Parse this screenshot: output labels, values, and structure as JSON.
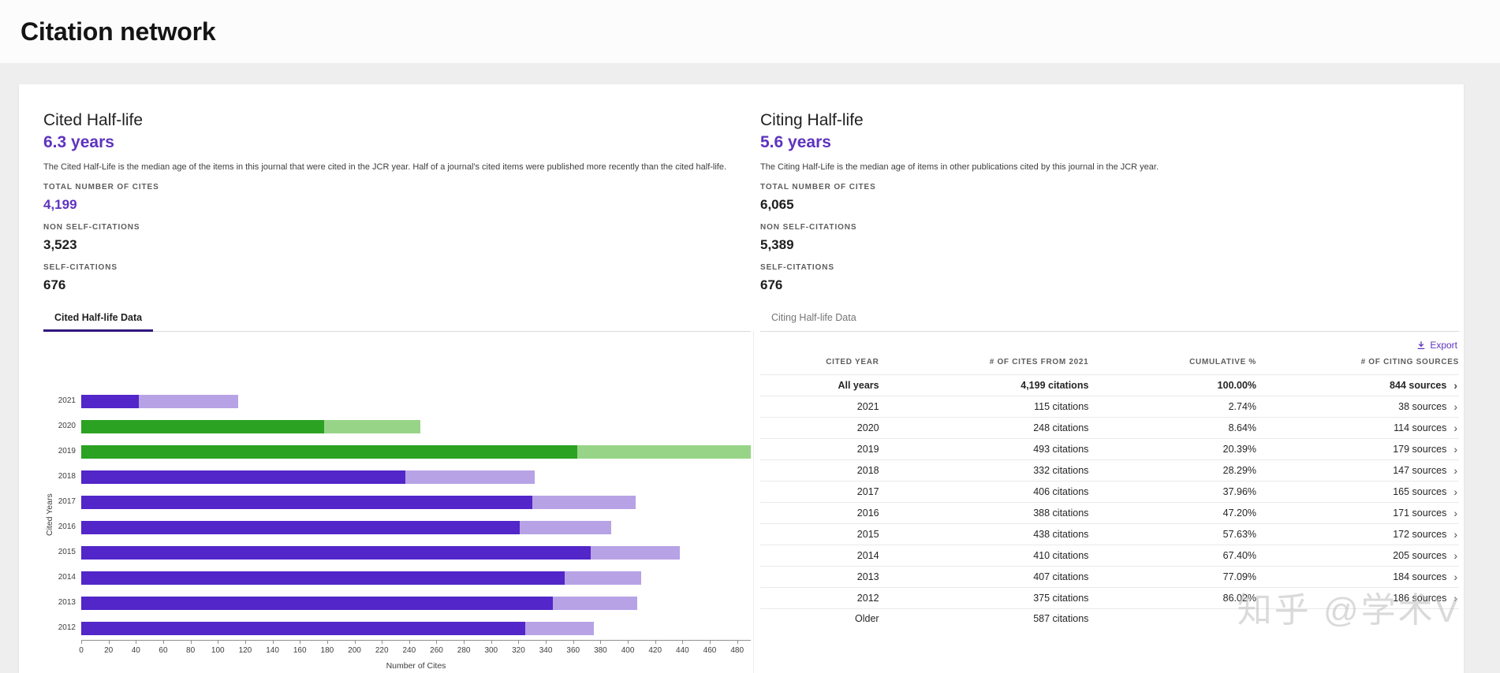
{
  "page": {
    "title": "Citation network"
  },
  "cited_panel": {
    "title": "Cited Half-life",
    "value": "6.3 years",
    "description": "The Cited Half-Life is the median age of the items in this journal that were cited in the JCR year. Half of a journal's cited items were published more recently than the cited half-life.",
    "stats": [
      {
        "label": "TOTAL NUMBER OF CITES",
        "value": "4,199"
      },
      {
        "label": "NON SELF-CITATIONS",
        "value": "3,523"
      },
      {
        "label": "SELF-CITATIONS",
        "value": "676"
      }
    ],
    "tab_label": "Cited Half-life Data"
  },
  "citing_panel": {
    "title": "Citing Half-life",
    "value": "5.6 years",
    "description": "The Citing Half-Life is the median age of items in other publications cited by this journal in the JCR year.",
    "stats": [
      {
        "label": "TOTAL NUMBER OF CITES",
        "value": "6,065"
      },
      {
        "label": "NON SELF-CITATIONS",
        "value": "5,389"
      },
      {
        "label": "SELF-CITATIONS",
        "value": "676"
      }
    ],
    "tab_label": "Citing Half-life Data"
  },
  "toolbar": {
    "export_label": "Export"
  },
  "chart_data": {
    "type": "bar",
    "orientation": "horizontal",
    "title": "",
    "xlabel": "Number of Cites",
    "ylabel": "Cited Years",
    "xlim": [
      0,
      490
    ],
    "xticks": [
      0,
      20,
      40,
      60,
      80,
      100,
      120,
      140,
      160,
      180,
      200,
      220,
      240,
      260,
      280,
      300,
      320,
      340,
      360,
      380,
      400,
      420,
      440,
      460,
      480
    ],
    "categories": [
      "2021",
      "2020",
      "2019",
      "2018",
      "2017",
      "2016",
      "2015",
      "2014",
      "2013",
      "2012"
    ],
    "series": [
      {
        "name": "non-self-citations",
        "values": [
          42,
          178,
          363,
          237,
          330,
          321,
          373,
          354,
          345,
          325
        ]
      },
      {
        "name": "self-citations",
        "values": [
          73,
          70,
          130,
          95,
          76,
          67,
          65,
          56,
          62,
          50
        ]
      }
    ],
    "totals": [
      115,
      248,
      493,
      332,
      406,
      388,
      438,
      410,
      407,
      375
    ],
    "color_scheme": [
      "purple",
      "green",
      "green",
      "purple",
      "purple",
      "purple",
      "purple",
      "purple",
      "purple",
      "purple"
    ],
    "colors": {
      "purple": {
        "dark": "#5226c9",
        "light": "#b7a2e6"
      },
      "green": {
        "dark": "#2ba222",
        "light": "#97d488"
      }
    },
    "grid": false,
    "legend_position": "none"
  },
  "table": {
    "headers": [
      "CITED YEAR",
      "# OF CITES FROM 2021",
      "CUMULATIVE %",
      "# OF CITING SOURCES"
    ],
    "rows": [
      {
        "year": "All years",
        "cites": "4,199 citations",
        "cumulative": "100.00%",
        "sources": "844 sources",
        "bold": true
      },
      {
        "year": "2021",
        "cites": "115 citations",
        "cumulative": "2.74%",
        "sources": "38 sources"
      },
      {
        "year": "2020",
        "cites": "248 citations",
        "cumulative": "8.64%",
        "sources": "114 sources"
      },
      {
        "year": "2019",
        "cites": "493 citations",
        "cumulative": "20.39%",
        "sources": "179 sources"
      },
      {
        "year": "2018",
        "cites": "332 citations",
        "cumulative": "28.29%",
        "sources": "147 sources"
      },
      {
        "year": "2017",
        "cites": "406 citations",
        "cumulative": "37.96%",
        "sources": "165 sources"
      },
      {
        "year": "2016",
        "cites": "388 citations",
        "cumulative": "47.20%",
        "sources": "171 sources"
      },
      {
        "year": "2015",
        "cites": "438 citations",
        "cumulative": "57.63%",
        "sources": "172 sources"
      },
      {
        "year": "2014",
        "cites": "410 citations",
        "cumulative": "67.40%",
        "sources": "205 sources"
      },
      {
        "year": "2013",
        "cites": "407 citations",
        "cumulative": "77.09%",
        "sources": "184 sources"
      },
      {
        "year": "2012",
        "cites": "375 citations",
        "cumulative": "86.02%",
        "sources": "186 sources"
      },
      {
        "year": "Older",
        "cites": "587 citations",
        "cumulative": "",
        "sources": ""
      }
    ]
  },
  "watermark": "知乎 @学术V"
}
